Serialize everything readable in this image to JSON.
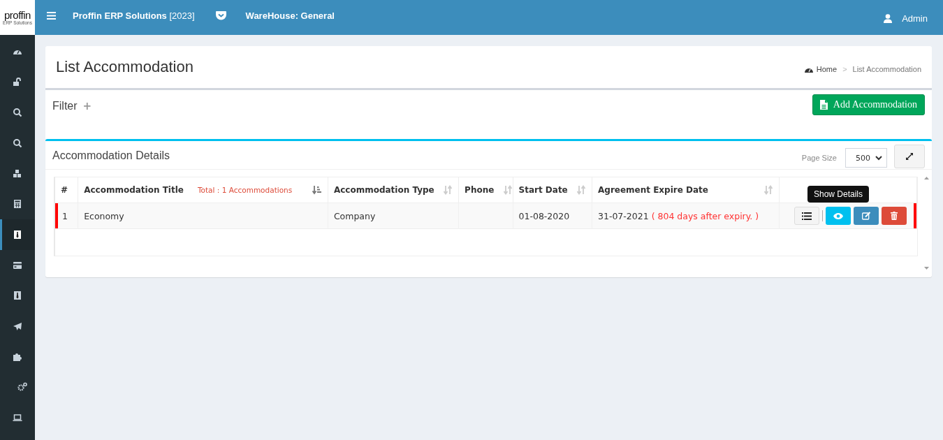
{
  "logo": {
    "name": "proffin",
    "tagline": "ERP Solutions"
  },
  "topbar": {
    "app": "Proffin ERP Solutions",
    "year": "[2023]",
    "warehouse": "WareHouse: General",
    "user": "Admin"
  },
  "sidebar": {
    "items": [
      {
        "selected": false
      },
      {
        "selected": false
      },
      {
        "selected": false
      },
      {
        "selected": false
      },
      {
        "selected": false
      },
      {
        "selected": false
      },
      {
        "selected": true
      },
      {
        "selected": false
      },
      {
        "selected": false
      },
      {
        "selected": false
      },
      {
        "selected": false
      },
      {
        "selected": false
      },
      {
        "selected": false
      }
    ]
  },
  "page": {
    "title": "List Accommodation",
    "breadcrumb": [
      "Home",
      ">",
      "List Accommodation"
    ]
  },
  "filter": {
    "label": "Filter",
    "toggle": "+",
    "add_button": "Add Accommodation"
  },
  "details": {
    "title": "Accommodation Details",
    "page_size_label": "Page Size",
    "page_size": "500"
  },
  "table": {
    "total": "Total : 1 Accommodations",
    "columns": [
      {
        "label": "#",
        "sortable": false
      },
      {
        "label": "Accommodation Title",
        "sortable": true,
        "sorted": true
      },
      {
        "label": "Accommodation Type",
        "sortable": true,
        "sorted": false
      },
      {
        "label": "Phone",
        "sortable": true,
        "sorted": false
      },
      {
        "label": "Start Date",
        "sortable": true,
        "sorted": false
      },
      {
        "label": "Agreement Expire Date",
        "sortable": true,
        "sorted": false
      },
      {
        "sortable": false
      }
    ],
    "rows": [
      {
        "flagged": true,
        "cells": [
          "1",
          "Economy",
          "Company",
          "",
          "01-08-2020",
          "31-07-2021"
        ],
        "note": "( 804 days after expiry. )"
      }
    ]
  },
  "tooltip": "Show Details"
}
